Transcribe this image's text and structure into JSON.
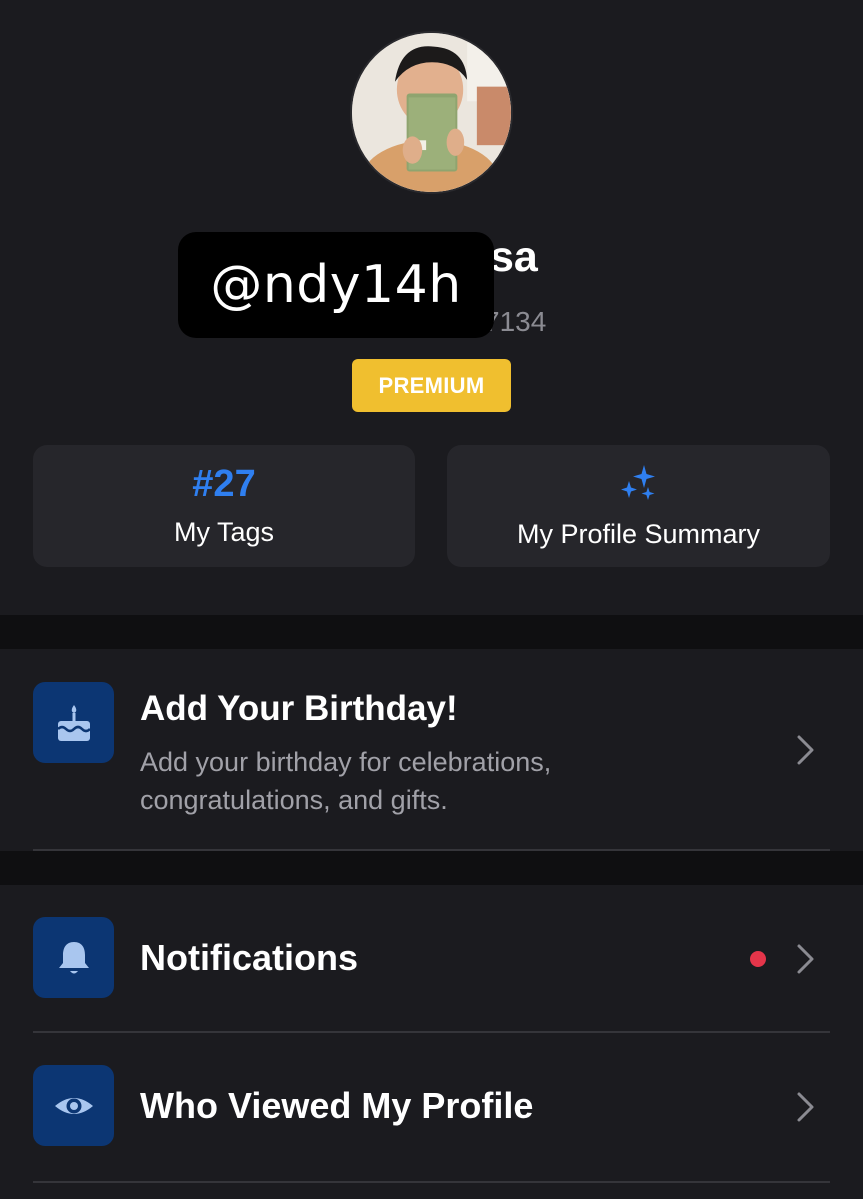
{
  "profile": {
    "username_redaction": "@ndy14h",
    "name_visible_suffix": "sa",
    "id_visible_suffix": "7134",
    "badge": "PREMIUM"
  },
  "stats": {
    "tags_count": "#27",
    "tags_label": "My Tags",
    "summary_label": "My Profile Summary"
  },
  "birthday": {
    "title": "Add Your Birthday!",
    "description": "Add your birthday for celebrations, congratulations, and gifts."
  },
  "menu": {
    "items": [
      {
        "label": "Notifications",
        "has_dot": true
      },
      {
        "label": "Who Viewed My Profile",
        "has_dot": false
      }
    ]
  },
  "colors": {
    "background": "#0f0f11",
    "card": "#1b1b1f",
    "tile": "#26262b",
    "premium": "#f0bf2f",
    "accent_blue": "#2f7ff0",
    "icon_box": "#0c3673",
    "notification_dot": "#e5354a"
  },
  "icons": [
    "avatar-photo",
    "sparkle-icon",
    "birthday-cake-icon",
    "bell-icon",
    "eye-icon",
    "chevron-right-icon"
  ]
}
